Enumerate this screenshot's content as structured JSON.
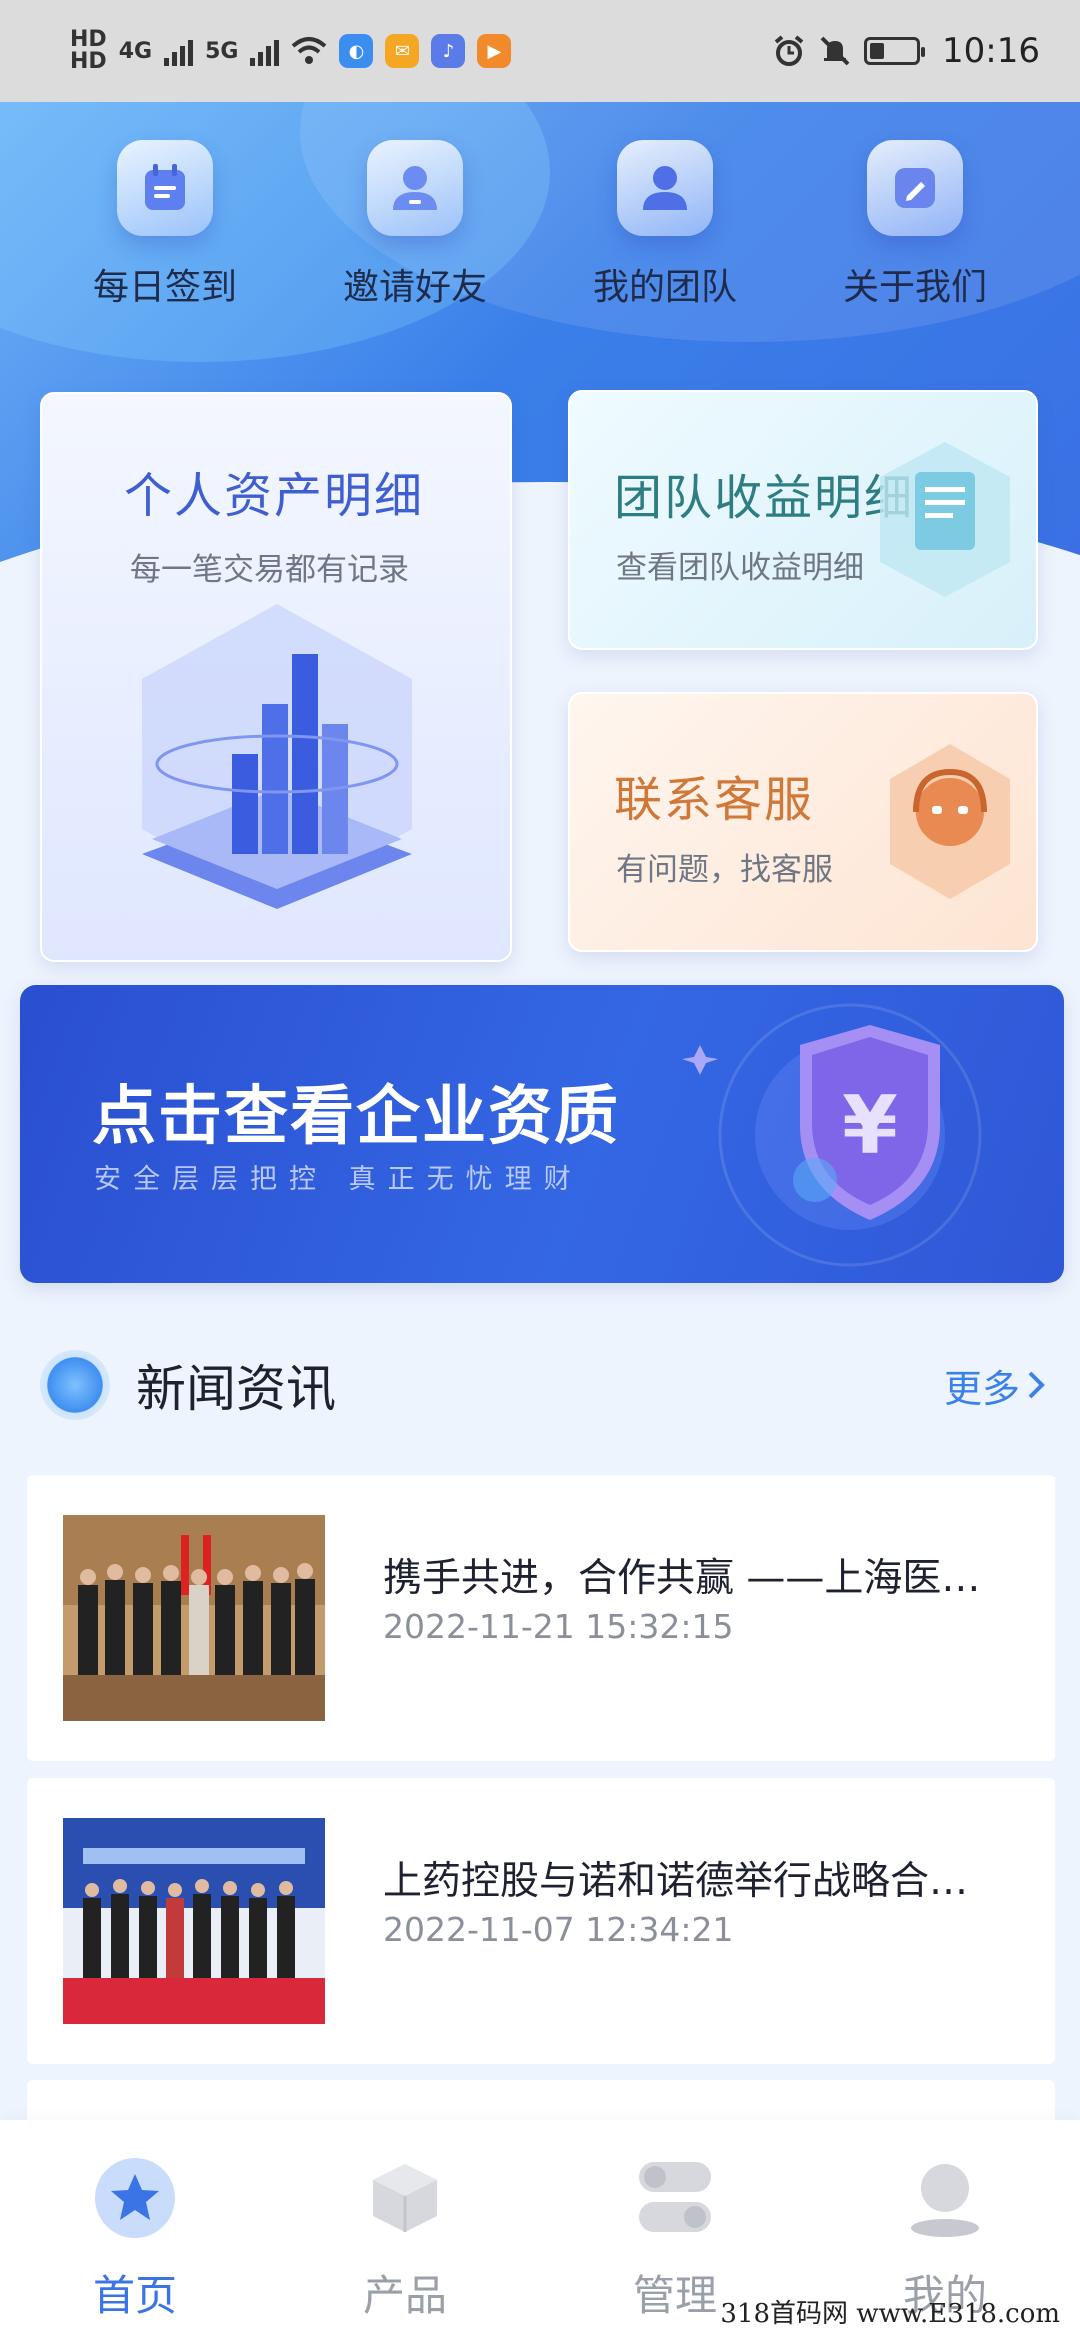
{
  "status_bar": {
    "network1": "HD",
    "network2": "HD",
    "signal1": "4G",
    "signal2": "5G",
    "time": "10:16"
  },
  "quick_nav": [
    {
      "label": "每日签到",
      "icon": "calendar-check-icon"
    },
    {
      "label": "邀请好友",
      "icon": "person-icon"
    },
    {
      "label": "我的团队",
      "icon": "team-icon"
    },
    {
      "label": "关于我们",
      "icon": "pencil-icon"
    }
  ],
  "cards": {
    "asset": {
      "title": "个人资产明细",
      "subtitle": "每一笔交易都有记录"
    },
    "team": {
      "title": "团队收益明细",
      "subtitle": "查看团队收益明细"
    },
    "service": {
      "title": "联系客服",
      "subtitle": "有问题，找客服"
    }
  },
  "banner": {
    "title": "点击查看企业资质",
    "subtitle": "安全层层把控 真正无忧理财",
    "shield_symbol": "¥"
  },
  "news": {
    "title": "新闻资讯",
    "more": "更多",
    "items": [
      {
        "headline": "携手共进，合作共赢 ——上海医…",
        "date": "2022-11-21 15:32:15"
      },
      {
        "headline": "上药控股与诺和诺德举行战略合…",
        "date": "2022-11-07 12:34:21"
      }
    ]
  },
  "tabs": [
    {
      "label": "首页",
      "icon": "star-icon",
      "active": true
    },
    {
      "label": "产品",
      "icon": "cube-icon",
      "active": false
    },
    {
      "label": "管理",
      "icon": "toggle-icon",
      "active": false
    },
    {
      "label": "我的",
      "icon": "user-icon",
      "active": false
    }
  ],
  "colors": {
    "accent": "#3a74e5",
    "team_title": "#2e7d83",
    "service_title": "#d0773a",
    "asset_title": "#3f5fd1"
  },
  "watermark": "318首码网 www.E318.com"
}
